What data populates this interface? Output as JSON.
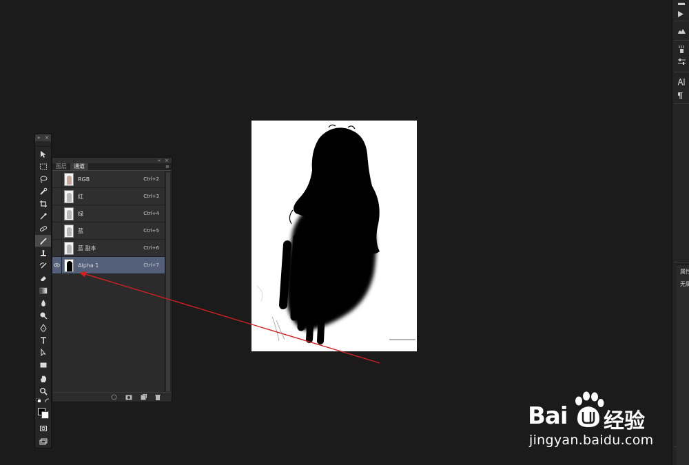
{
  "toolbox": {
    "collapse_glyph": "»",
    "close_glyph": "×",
    "active_tool": "brush-tool"
  },
  "panel": {
    "collapse_glyph": "«",
    "close_glyph": "×",
    "menu_glyph": "≡",
    "tabs": [
      {
        "label": "图层",
        "active": false
      },
      {
        "label": "通道",
        "active": true
      }
    ],
    "channels": [
      {
        "name": "RGB",
        "shortcut": "Ctrl+2",
        "visible": false,
        "selected": false,
        "thumb": "color"
      },
      {
        "name": "红",
        "shortcut": "Ctrl+3",
        "visible": false,
        "selected": false,
        "thumb": "gray"
      },
      {
        "name": "绿",
        "shortcut": "Ctrl+4",
        "visible": false,
        "selected": false,
        "thumb": "gray"
      },
      {
        "name": "蓝",
        "shortcut": "Ctrl+5",
        "visible": false,
        "selected": false,
        "thumb": "gray"
      },
      {
        "name": "蓝 副本",
        "shortcut": "Ctrl+6",
        "visible": false,
        "selected": false,
        "thumb": "gray"
      },
      {
        "name": "Alpha 1",
        "shortcut": "Ctrl+7",
        "visible": true,
        "selected": true,
        "thumb": "alpha"
      }
    ],
    "eye_glyph": "👁"
  },
  "right_panel": {
    "label_1": "属性",
    "label_2": "无属"
  },
  "watermark": {
    "brand_left": "Bai",
    "brand_right": "经验",
    "url": "jingyan.baidu.com"
  },
  "colors": {
    "app_bg": "#1b1b1b",
    "panel_bg": "#2b2b2b",
    "selected_row": "#546079",
    "arrow": "#d42020"
  }
}
